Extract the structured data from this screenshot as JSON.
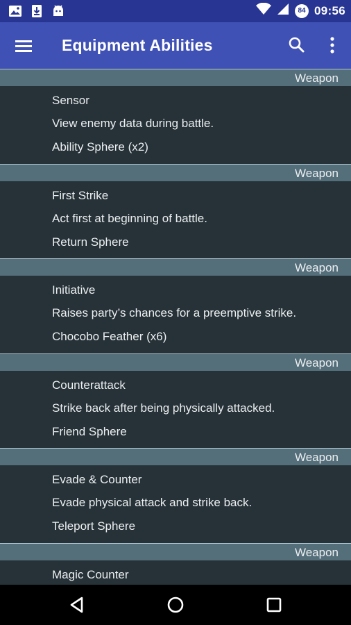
{
  "status_bar": {
    "time": "09:56",
    "battery_level": "84",
    "left_icons": [
      "image-icon",
      "download-icon",
      "android-icon"
    ],
    "right_icons": [
      "wifi-icon",
      "signal-icon"
    ]
  },
  "app_bar": {
    "title": "Equipment Abilities",
    "icons": [
      "menu-icon",
      "search-icon",
      "more-vert-icon"
    ]
  },
  "items": [
    {
      "category": "Weapon",
      "name": "Sensor",
      "description": "View enemy data during battle.",
      "requirement": "Ability Sphere (x2)"
    },
    {
      "category": "Weapon",
      "name": "First Strike",
      "description": "Act first at beginning of battle.",
      "requirement": "Return Sphere"
    },
    {
      "category": "Weapon",
      "name": "Initiative",
      "description": "Raises party’s chances for a preemptive strike.",
      "requirement": "Chocobo Feather (x6)"
    },
    {
      "category": "Weapon",
      "name": "Counterattack",
      "description": "Strike back after being physically attacked.",
      "requirement": "Friend Sphere"
    },
    {
      "category": "Weapon",
      "name": "Evade & Counter",
      "description": "Evade physical attack and strike back.",
      "requirement": "Teleport Sphere"
    },
    {
      "category": "Weapon",
      "name": "Magic Counter",
      "description": "",
      "requirement": ""
    }
  ],
  "nav_bar": {
    "icons": [
      "back-icon",
      "home-icon",
      "recents-icon"
    ]
  },
  "colors": {
    "status_bar": "#283593",
    "app_bar": "#3f51b5",
    "background": "#263238",
    "header": "#546e7a",
    "text": "#eceff1"
  }
}
